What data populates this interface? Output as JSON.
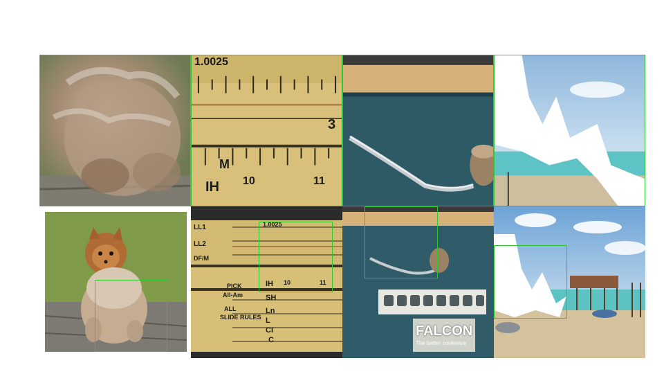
{
  "colors": {
    "highlight": "#2ec82e",
    "background": "#ffffff"
  },
  "panels": {
    "ruler": {
      "zoom_top_number": "1.0025",
      "zoom_right_number": "3",
      "zoom_scale_m": "M",
      "zoom_scale_ih": "IH",
      "zoom_10": "10",
      "zoom_11": "11",
      "full_ll1": "LL1",
      "full_ll2": "LL2",
      "full_dfm": "DF/M",
      "full_top_number": "1.0025",
      "full_pick": "PICK",
      "full_all_am": "All-Am",
      "full_all": "ALL",
      "full_slide_rules": "SLIDE RULES",
      "full_sh": "SH",
      "full_ih": "IH",
      "full_ln": "Ln",
      "full_l": "L",
      "full_ci": "CI",
      "full_c": "C",
      "full_10": "10",
      "full_11": "11"
    },
    "falcon": {
      "brand": "FALCON",
      "tagline": "The better cookware"
    }
  }
}
